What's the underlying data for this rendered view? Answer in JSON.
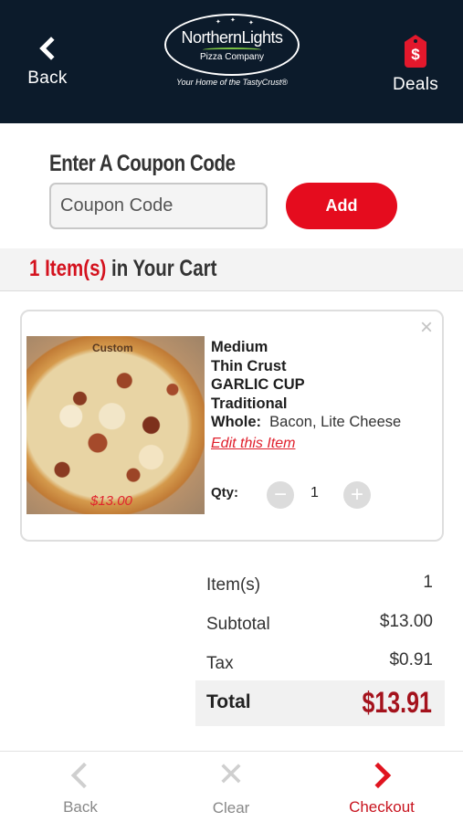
{
  "header": {
    "back_label": "Back",
    "deals_label": "Deals",
    "deals_icon_text": "$",
    "logo": {
      "name": "NorthernLights",
      "company": "Pizza Company",
      "tagline": "Your Home of the TastyCrust®"
    }
  },
  "coupon": {
    "title": "Enter A Coupon Code",
    "placeholder": "Coupon Code",
    "add_label": "Add"
  },
  "cart": {
    "count": "1",
    "count_suffix": "Item(s)",
    "heading_rest": " in Your Cart"
  },
  "item": {
    "image_label": "Custom",
    "image_price": "$13.00",
    "size": "Medium",
    "crust": "Thin Crust",
    "cup": "GARLIC CUP",
    "sauce": "Traditional",
    "whole_label": "Whole:",
    "whole_value": "Bacon, Lite Cheese",
    "edit_label": "Edit this Item",
    "qty_label": "Qty:",
    "qty_value": "1",
    "remove_icon": "×"
  },
  "summary": {
    "items_label": "Item(s)",
    "items_value": "1",
    "subtotal_label": "Subtotal",
    "subtotal_value": "$13.00",
    "tax_label": "Tax",
    "tax_value": "$0.91",
    "total_label": "Total",
    "total_value": "$13.91"
  },
  "footer": {
    "back_label": "Back",
    "clear_label": "Clear",
    "checkout_label": "Checkout"
  },
  "colors": {
    "header_bg": "#0c1b2b",
    "accent_red": "#e50c1e",
    "total_red": "#a4121c"
  }
}
